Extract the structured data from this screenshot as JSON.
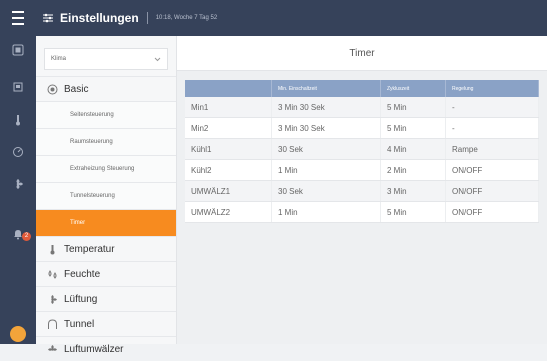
{
  "header": {
    "title": "Einstellungen",
    "subtitle": "10:18, Woche 7 Tag 52"
  },
  "sidebar": {
    "select_value": "Klima",
    "sections": [
      {
        "label": "Basic",
        "icon": "sun-icon"
      },
      {
        "label": "Temperatur",
        "icon": "thermometer-icon"
      },
      {
        "label": "Feuchte",
        "icon": "humidity-icon"
      },
      {
        "label": "Lüftung",
        "icon": "fan-icon"
      },
      {
        "label": "Tunnel",
        "icon": "tunnel-icon"
      },
      {
        "label": "Luftumwälzer",
        "icon": "circulator-icon"
      }
    ],
    "basic_items": [
      {
        "label": "Seitensteuerung"
      },
      {
        "label": "Raumsteuerung"
      },
      {
        "label": "Extraheizung Steuerung"
      },
      {
        "label": "Tunnelsteuerung"
      },
      {
        "label": "Timer",
        "active": true
      }
    ]
  },
  "rail": {
    "badge_count": "2"
  },
  "main": {
    "title": "Timer",
    "table": {
      "headers": [
        "",
        "Min. Einschaltzeit",
        "Zykluszeit",
        "Regelung"
      ],
      "rows": [
        [
          "Min1",
          "3 Min 30 Sek",
          "5 Min",
          "-"
        ],
        [
          "Min2",
          "3 Min 30 Sek",
          "5 Min",
          "-"
        ],
        [
          "Kühl1",
          "30 Sek",
          "4 Min",
          "Rampe"
        ],
        [
          "Kühl2",
          "1 Min",
          "2 Min",
          "ON/OFF"
        ],
        [
          "UMWÄLZ1",
          "30 Sek",
          "3 Min",
          "ON/OFF"
        ],
        [
          "UMWÄLZ2",
          "1 Min",
          "5 Min",
          "ON/OFF"
        ]
      ]
    }
  },
  "colors": {
    "header_bg": "#36425a",
    "accent": "#f78b1f",
    "table_header": "#8aa2c6",
    "badge": "#e05a3a"
  }
}
